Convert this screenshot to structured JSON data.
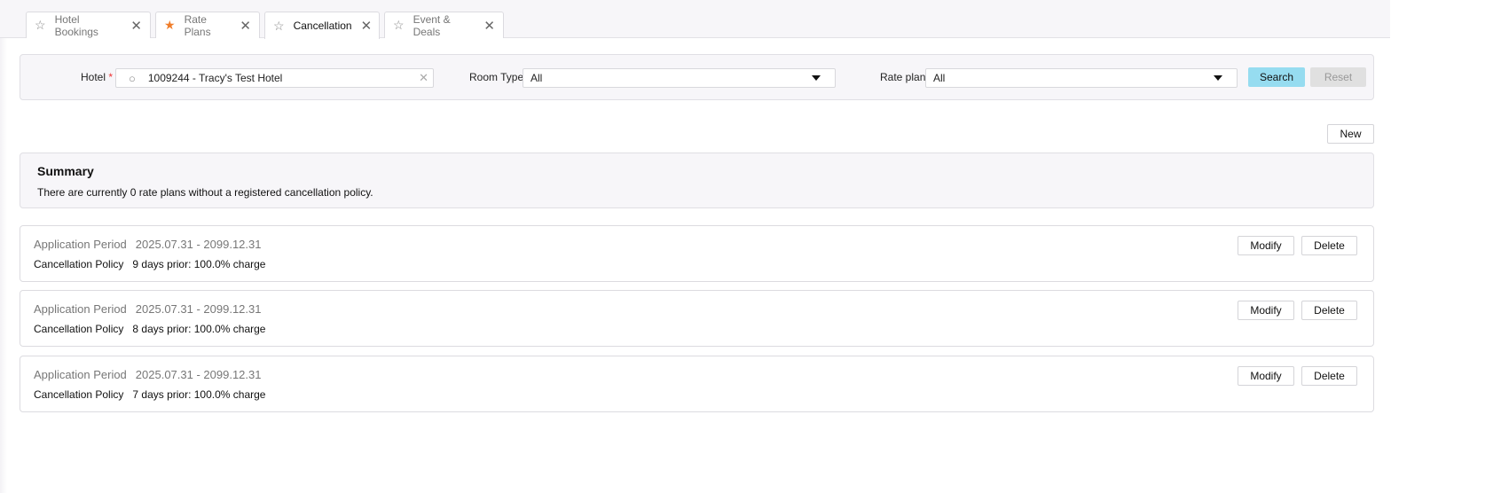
{
  "tabs": [
    {
      "label": "Hotel Bookings",
      "favorite": false,
      "active": false
    },
    {
      "label": "Rate Plans",
      "favorite": true,
      "active": false
    },
    {
      "label": "Cancellation",
      "favorite": false,
      "active": true
    },
    {
      "label": "Event & Deals",
      "favorite": false,
      "active": false
    }
  ],
  "filter": {
    "hotel_label": "Hotel",
    "required_mark": "*",
    "hotel_value": "1009244 - Tracy's Test Hotel",
    "room_type_label": "Room Type",
    "room_type_value": "All",
    "rate_plan_label": "Rate plan",
    "rate_plan_value": "All",
    "search_label": "Search",
    "reset_label": "Reset"
  },
  "new_label": "New",
  "summary": {
    "title": "Summary",
    "text": "There are currently 0 rate plans without a registered cancellation policy."
  },
  "policies": [
    {
      "period_label": "Application Period",
      "period": "2025.07.31 - 2099.12.31",
      "policy_label": "Cancellation Policy",
      "policy": "9 days prior: 100.0% charge"
    },
    {
      "period_label": "Application Period",
      "period": "2025.07.31 - 2099.12.31",
      "policy_label": "Cancellation Policy",
      "policy": "8 days prior: 100.0% charge"
    },
    {
      "period_label": "Application Period",
      "period": "2025.07.31 - 2099.12.31",
      "policy_label": "Cancellation Policy",
      "policy": "7 days prior: 100.0% charge"
    }
  ],
  "modify_label": "Modify",
  "delete_label": "Delete",
  "colors": {
    "accent": "#96dcf0",
    "favorite": "#f07d2a"
  }
}
